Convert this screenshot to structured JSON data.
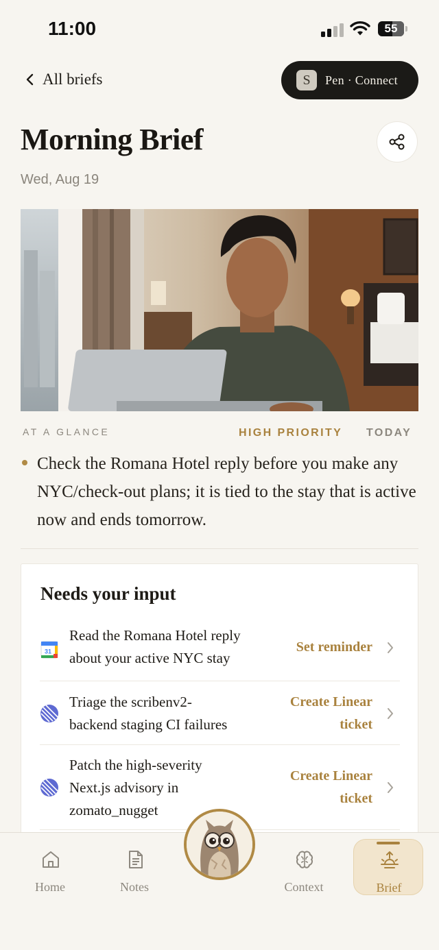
{
  "status_bar": {
    "time": "11:00",
    "battery_level": "55",
    "icons": [
      "cellular-signal-icon",
      "wifi-icon",
      "battery-icon"
    ]
  },
  "nav": {
    "back_label": "All briefs",
    "connect_badge": "S",
    "connect_label": "Pen · Connect"
  },
  "header": {
    "title": "Morning Brief",
    "date": "Wed, Aug 19"
  },
  "glance": {
    "section_label": "AT A GLANCE",
    "priority_label": "HIGH PRIORITY",
    "when_label": "TODAY",
    "text": "Check the Romana Hotel reply before you make any NYC/check-out plans; it is tied to the stay that is active now and ends tomorrow."
  },
  "input_card": {
    "title": "Needs your input",
    "items": [
      {
        "icon": "google-calendar-icon",
        "calendar_day": "31",
        "text_line1": "Read the Romana Hotel reply",
        "text_line2": "about your active NYC stay",
        "text_line3": "",
        "action_line1": "Set reminder",
        "action_line2": ""
      },
      {
        "icon": "linear-icon",
        "text_line1": "Triage the scribenv2-",
        "text_line2": "backend staging CI failures",
        "text_line3": "",
        "action_line1": "Create Linear",
        "action_line2": "ticket"
      },
      {
        "icon": "linear-icon",
        "text_line1": "Patch the high-severity",
        "text_line2": "Next.js advisory in",
        "text_line3": "zomato_nugget",
        "action_line1": "Create Linear",
        "action_line2": "ticket"
      }
    ]
  },
  "tab_bar": {
    "tabs": [
      {
        "label": "Home",
        "icon": "home-icon"
      },
      {
        "label": "Notes",
        "icon": "notes-icon"
      },
      {
        "label": "Context",
        "icon": "brain-icon"
      },
      {
        "label": "Brief",
        "icon": "sunrise-icon"
      }
    ],
    "active_tab": "Brief",
    "center_button_icon": "owl-avatar-icon"
  },
  "colors": {
    "background": "#f7f5f0",
    "accent_gold": "#a9823e",
    "dark_pill": "#1b1a17",
    "linear_purple": "#5e6ad2"
  }
}
